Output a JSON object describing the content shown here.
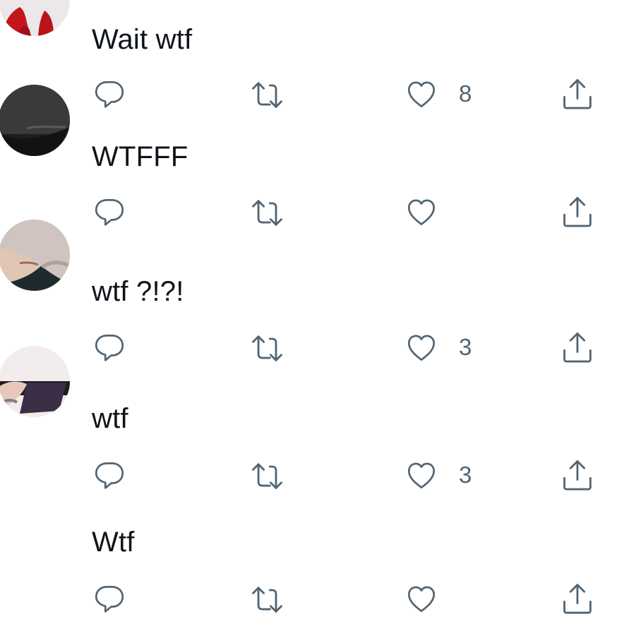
{
  "replies": [
    {
      "text": "Wait wtf",
      "likes": "8"
    },
    {
      "text": "WTFFF",
      "likes": ""
    },
    {
      "text": "wtf ?!?!",
      "likes": "3"
    },
    {
      "text": "wtf",
      "likes": "3"
    },
    {
      "text": "Wtf",
      "likes": ""
    }
  ],
  "colors": {
    "text": "#0f1419",
    "icon": "#536471",
    "background": "#ffffff"
  },
  "icons": [
    "reply-icon",
    "retweet-icon",
    "like-icon",
    "share-icon"
  ]
}
